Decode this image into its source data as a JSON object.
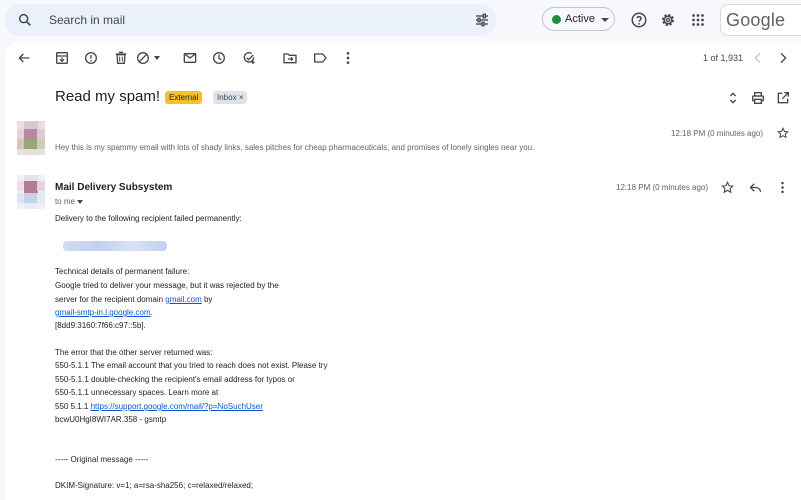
{
  "search": {
    "placeholder": "Search in mail",
    "icon": "search-icon",
    "filter_icon": "tune-icon"
  },
  "status": {
    "label": "Active",
    "dot_color": "#1e8e3e"
  },
  "top_icons": [
    "help-icon",
    "settings-icon",
    "apps-grid-icon"
  ],
  "logo_text": "Google",
  "toolbar": {
    "icons": [
      "back-arrow-icon",
      "archive-icon",
      "report-spam-icon",
      "delete-icon",
      "snooze-block-icon",
      "mark-unread-icon",
      "snooze-icon",
      "add-task-icon",
      "move-to-icon",
      "label-icon",
      "more-vert-icon"
    ],
    "pager": "1 of 1,931"
  },
  "subject": "Read my spam!",
  "chips": {
    "external": "External",
    "inbox": "Inbox",
    "inbox_close": "×"
  },
  "message1": {
    "time": "12:18 PM (0 minutes ago)",
    "snippet": "Hey this is my spammy email with lots of shady links, sales pitches for cheap pharmaceuticals, and promises of lonely singles near you."
  },
  "message2": {
    "sender": "Mail Delivery Subsystem",
    "to": "to me",
    "time": "12:18 PM (0 minutes ago)",
    "body": {
      "line1": "Delivery to the following recipient failed permanently:",
      "tech_header": "Technical details of permanent failure:",
      "tech1": "Google tried to deliver your message, but it was rejected by the",
      "tech2_pre": "server for the recipient domain ",
      "tech2_link": "gmail.com",
      "tech2_post": " by",
      "tech3_link": "gmail-smtp-in.l.google.com",
      "tech3_post": ".",
      "tech4": "[8dd9:3160:7f66:c97::5b].",
      "err_header": "The error that the other server returned was:",
      "err1": "550-5.1.1 The email account that you tried to reach does not exist. Please try",
      "err2": "550-5.1.1 double-checking the recipient's email address for typos or",
      "err3": "550-5.1.1 unnecessary spaces. Learn more at",
      "err4_pre": "550 5.1.1  ",
      "err4_link": "https://support.google.com/mail/?p=NoSuchUser",
      "err5": "bcwU0HgI8WI7AR.358 - gsmtp",
      "orig": "----- Original message -----",
      "dkim": "DKIM-Signature: v=1; a=rsa-sha256; c=relaxed/relaxed;"
    }
  }
}
